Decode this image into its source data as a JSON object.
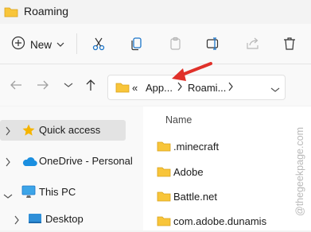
{
  "window": {
    "title": "Roaming"
  },
  "toolbar": {
    "new_label": "New",
    "icons": [
      "cut-icon",
      "copy-icon",
      "paste-icon",
      "rename-icon",
      "share-icon",
      "delete-icon"
    ]
  },
  "address": {
    "overflow": "«",
    "crumbs": [
      "App...",
      "Roami..."
    ]
  },
  "nav_pane": {
    "items": [
      {
        "label": "Quick access",
        "icon": "star-icon",
        "selected": true
      },
      {
        "label": "OneDrive - Personal",
        "icon": "cloud-icon"
      },
      {
        "label": "This PC",
        "icon": "monitor-icon",
        "expanded": true
      },
      {
        "label": "Desktop",
        "icon": "desktop-icon"
      }
    ]
  },
  "files": {
    "column_name": "Name",
    "items": [
      ".minecraft",
      "Adobe",
      "Battle.net",
      "com.adobe.dunamis"
    ]
  },
  "watermark": "@thegeekpage.com",
  "colors": {
    "folder": "#f8c53a",
    "accent": "#1b8fe0",
    "annotation_arrow": "#e0312a",
    "star": "#f5b400"
  }
}
